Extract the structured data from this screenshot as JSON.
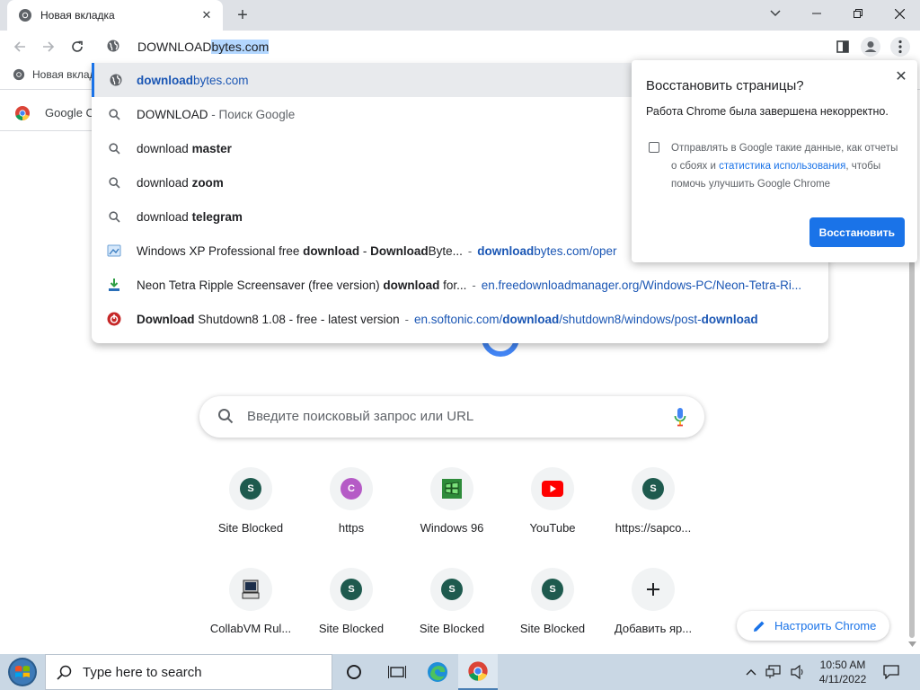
{
  "tab": {
    "title": "Новая вкладка"
  },
  "omnibox": {
    "typed": "DOWNLOAD",
    "autocomplete": "bytes.com"
  },
  "bookmarks": {
    "item": "Новая вклад"
  },
  "google_chip": {
    "label": "Google C"
  },
  "suggestions": [
    {
      "type": "url",
      "parts": [
        [
          "b",
          "download"
        ],
        [
          "n",
          "bytes.com"
        ]
      ],
      "active": true
    },
    {
      "type": "search",
      "parts": [
        [
          "n",
          "DOWNLOAD"
        ],
        [
          "d",
          " - Поиск Google"
        ]
      ]
    },
    {
      "type": "search",
      "parts": [
        [
          "n",
          "download "
        ],
        [
          "b",
          "master"
        ]
      ]
    },
    {
      "type": "search",
      "parts": [
        [
          "n",
          "download "
        ],
        [
          "b",
          "zoom"
        ]
      ]
    },
    {
      "type": "search",
      "parts": [
        [
          "n",
          "download "
        ],
        [
          "b",
          "telegram"
        ]
      ]
    },
    {
      "type": "history",
      "icon": "windows-xp-icon",
      "parts": [
        [
          "n",
          "Windows XP Professional free "
        ],
        [
          "b",
          "download"
        ],
        [
          "n",
          " - "
        ],
        [
          "b",
          "Download"
        ],
        [
          "n",
          "Byte..."
        ]
      ],
      "link": [
        [
          "b",
          "download"
        ],
        [
          "n",
          "bytes.com/oper"
        ]
      ]
    },
    {
      "type": "history",
      "icon": "download-manager-icon",
      "parts": [
        [
          "n",
          "Neon Tetra Ripple Screensaver (free version) "
        ],
        [
          "b",
          "download"
        ],
        [
          "n",
          " for..."
        ]
      ],
      "link": [
        [
          "n",
          "en.freedownloadmanager.org/Windows-PC/Neon-Tetra-Ri..."
        ]
      ]
    },
    {
      "type": "history",
      "icon": "softonic-icon",
      "parts": [
        [
          "b",
          "Download"
        ],
        [
          "n",
          " Shutdown8 1.08 - free - latest version"
        ]
      ],
      "link": [
        [
          "n",
          "en.softonic.com/"
        ],
        [
          "b",
          "download"
        ],
        [
          "n",
          "/shutdown8/windows/post-"
        ],
        [
          "b",
          "download"
        ]
      ]
    }
  ],
  "restore_popup": {
    "title": "Восстановить страницы?",
    "message": "Работа Chrome была завершена некорректно.",
    "checkbox_pre": "Отправлять в Google такие данные, как отчеты о сбоях и ",
    "checkbox_link": "статистика использования",
    "checkbox_post": ", чтобы помочь улучшить Google Chrome",
    "button": "Восстановить",
    "checked": false
  },
  "ntp": {
    "search_placeholder": "Введите поисковый запрос или URL",
    "tiles_row1": [
      {
        "label": "Site Blocked",
        "letter": "S",
        "color": "#1e5a4e",
        "icon": "letter"
      },
      {
        "label": "https",
        "letter": "C",
        "color": "#b55bc6",
        "icon": "letter"
      },
      {
        "label": "Windows 96",
        "letter": "",
        "color": "",
        "icon": "windows96-icon"
      },
      {
        "label": "YouTube",
        "letter": "",
        "color": "",
        "icon": "youtube-icon"
      },
      {
        "label": "https://sapco...",
        "letter": "S",
        "color": "#1e5a4e",
        "icon": "letter"
      }
    ],
    "tiles_row2": [
      {
        "label": "CollabVM Rul...",
        "letter": "",
        "color": "",
        "icon": "collabvm-icon"
      },
      {
        "label": "Site Blocked",
        "letter": "S",
        "color": "#1e5a4e",
        "icon": "letter"
      },
      {
        "label": "Site Blocked",
        "letter": "S",
        "color": "#1e5a4e",
        "icon": "letter"
      },
      {
        "label": "Site Blocked",
        "letter": "S",
        "color": "#1e5a4e",
        "icon": "letter"
      },
      {
        "label": "Добавить яр...",
        "letter": "",
        "color": "",
        "icon": "plus-icon"
      }
    ],
    "customize": "Настроить Chrome"
  },
  "taskbar": {
    "search_placeholder": "Type here to search",
    "time": "10:50 AM",
    "date": "4/11/2022"
  }
}
